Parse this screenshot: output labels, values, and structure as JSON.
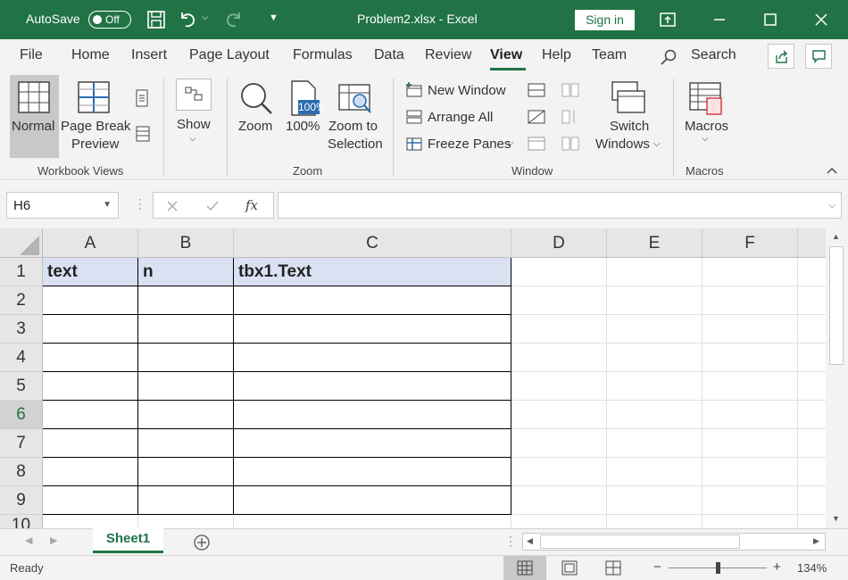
{
  "titlebar": {
    "autosave_label": "AutoSave",
    "autosave_state": "Off",
    "title": "Problem2.xlsx  -  Excel",
    "signin_label": "Sign in"
  },
  "menu": {
    "tabs": [
      "File",
      "Home",
      "Insert",
      "Page Layout",
      "Formulas",
      "Data",
      "Review",
      "View",
      "Help",
      "Team"
    ],
    "active_tab": "View",
    "search_label": "Search"
  },
  "ribbon": {
    "normal": "Normal",
    "page_break_1": "Page Break",
    "page_break_2": "Preview",
    "workbook_views_group": "Workbook Views",
    "show": "Show",
    "zoom": "Zoom",
    "zoom_100": "100%",
    "zoom_to_1": "Zoom to",
    "zoom_to_2": "Selection",
    "zoom_group": "Zoom",
    "new_window": "New Window",
    "arrange_all": "Arrange All",
    "freeze_panes": "Freeze Panes",
    "switch_1": "Switch",
    "switch_2": "Windows",
    "window_group": "Window",
    "macros": "Macros",
    "macros_group": "Macros"
  },
  "formula_bar": {
    "name_box": "H6",
    "fx": "fx",
    "formula": ""
  },
  "sheet": {
    "columns": [
      "A",
      "B",
      "C",
      "D",
      "E",
      "F"
    ],
    "rows": [
      "1",
      "2",
      "3",
      "4",
      "5",
      "6",
      "7",
      "8",
      "9",
      "10"
    ],
    "selected_row": "6",
    "header_cells": [
      "text",
      "n",
      "tbx1.Text"
    ]
  },
  "sheet_tabs": {
    "active": "Sheet1"
  },
  "statusbar": {
    "status": "Ready",
    "zoom_level": "134%"
  },
  "colors": {
    "accent": "#217346",
    "table_header_fill": "#d9e1f2"
  }
}
